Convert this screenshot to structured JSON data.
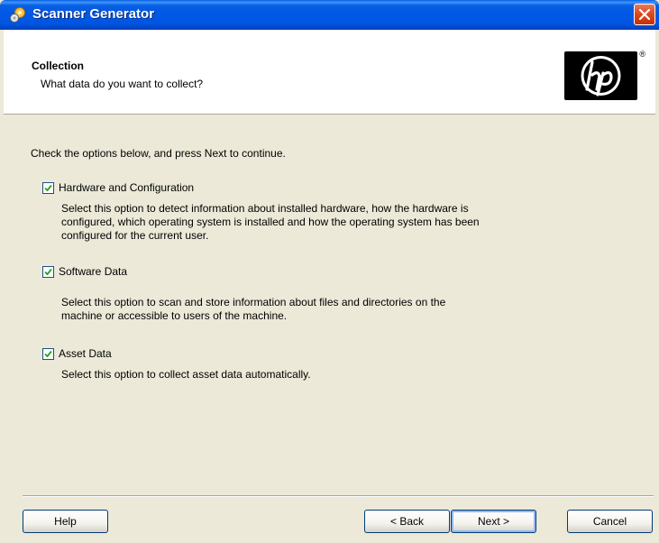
{
  "window": {
    "title": "Scanner Generator",
    "close_icon": "close-icon"
  },
  "header": {
    "title": "Collection",
    "subtitle": "What data do you want to collect?",
    "logo": "hp-logo"
  },
  "content": {
    "intro": "Check the options below, and press Next to continue.",
    "options": [
      {
        "label": "Hardware and Configuration",
        "checked": true,
        "description": "Select this option to detect information about installed hardware, how the hardware is configured, which operating system is installed and how the operating system has been configured for the current user."
      },
      {
        "label": "Software Data",
        "checked": true,
        "description": "Select this option to scan and store information about files and directories on the machine or accessible to users of the machine."
      },
      {
        "label": "Asset Data",
        "checked": true,
        "description": "Select this option to collect asset data automatically."
      }
    ]
  },
  "buttons": {
    "help": "Help",
    "back": "< Back",
    "next": "Next >",
    "cancel": "Cancel"
  },
  "colors": {
    "titlebar": "#0058e6",
    "dialog_bg": "#ece9d8",
    "close_button": "#d8481f",
    "checkmark": "#21a121"
  }
}
